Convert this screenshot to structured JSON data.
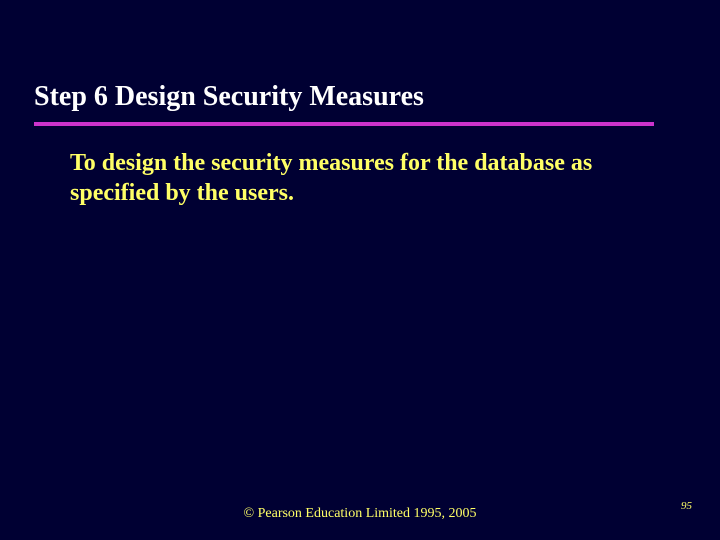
{
  "slide": {
    "title": "Step 6  Design Security Measures",
    "body": "To design the security measures for the database as specified by the users.",
    "footer": "© Pearson Education Limited 1995, 2005",
    "page_number": "95"
  }
}
